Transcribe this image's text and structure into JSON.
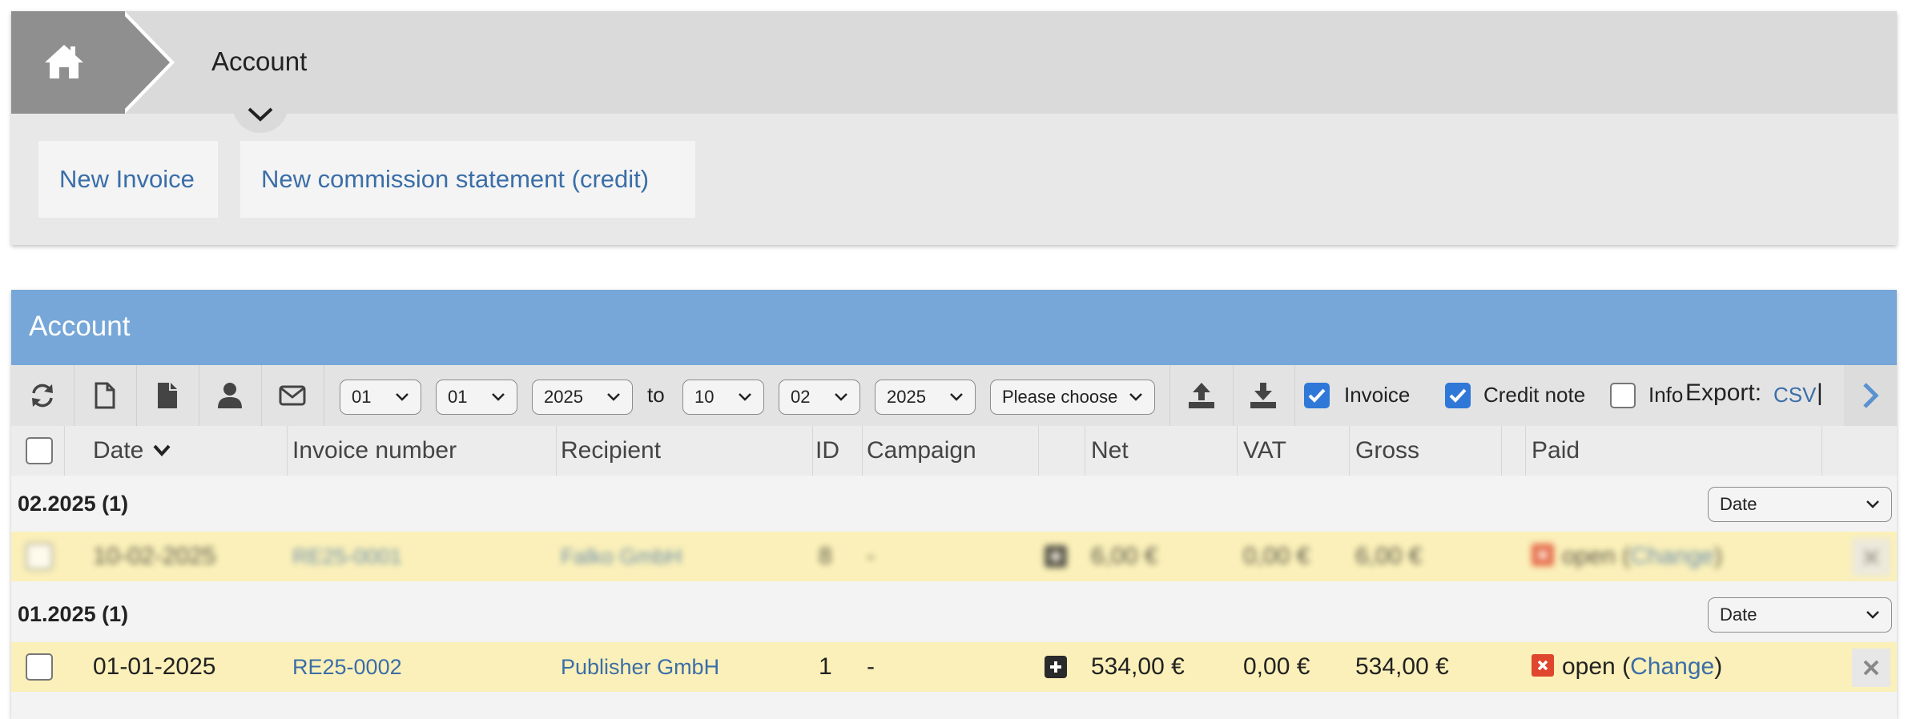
{
  "breadcrumb": {
    "title": "Account"
  },
  "actions": {
    "new_invoice": "New Invoice",
    "new_commission": "New commission statement (credit)"
  },
  "panel": {
    "title": "Account"
  },
  "toolbar": {
    "from_day": "01",
    "from_month": "01",
    "from_year": "2025",
    "to_label": "to",
    "to_day": "10",
    "to_month": "02",
    "to_year": "2025",
    "filter_placeholder": "Please choose",
    "invoice_label": "Invoice",
    "invoice_checked": true,
    "credit_label": "Credit note",
    "credit_checked": true,
    "info_label": "Info",
    "info_checked": false,
    "export_label": "Export:",
    "export_csv": "CSV",
    "export_sep": "|"
  },
  "columns": {
    "date": "Date",
    "invoice_number": "Invoice number",
    "recipient": "Recipient",
    "id": "ID",
    "campaign": "Campaign",
    "net": "Net",
    "vat": "VAT",
    "gross": "Gross",
    "paid": "Paid"
  },
  "groups": [
    {
      "label": "02.2025 (1)",
      "sort": "Date",
      "rows": [
        {
          "date": "10-02-2025",
          "invoice": "RE25-0001",
          "recipient": "Falko GmbH",
          "id": "8",
          "campaign": "-",
          "net": "6,00 €",
          "vat": "0,00 €",
          "gross": "6,00 €",
          "status": "open",
          "paren_open": "(",
          "change": "Change",
          "paren_close": ")"
        }
      ]
    },
    {
      "label": "01.2025 (1)",
      "sort": "Date",
      "rows": [
        {
          "date": "01-01-2025",
          "invoice": "RE25-0002",
          "recipient": "Publisher GmbH",
          "id": "1",
          "campaign": "-",
          "net": "534,00 €",
          "vat": "0,00 €",
          "gross": "534,00 €",
          "status": "open",
          "paren_open": "(",
          "change": "Change",
          "paren_close": ")"
        }
      ]
    }
  ],
  "colors": {
    "header_blue": "#76a7d8",
    "link": "#3a6ea8",
    "row_highlight": "#fbf0b9",
    "status_open": "#e0452d"
  }
}
